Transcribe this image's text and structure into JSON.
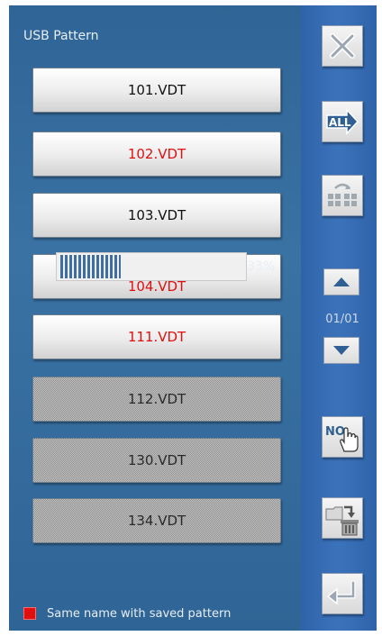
{
  "screen": {
    "title": "USB Pattern"
  },
  "files": [
    {
      "label": "101.VDT",
      "state": "normal"
    },
    {
      "label": "102.VDT",
      "state": "same-name"
    },
    {
      "label": "103.VDT",
      "state": "normal"
    },
    {
      "label": "104.VDT",
      "state": "same-name"
    },
    {
      "label": "111.VDT",
      "state": "same-name"
    },
    {
      "label": "112.VDT",
      "state": "disabled"
    },
    {
      "label": "130.VDT",
      "state": "disabled"
    },
    {
      "label": "134.VDT",
      "state": "disabled"
    }
  ],
  "progress": {
    "value_percent": 33,
    "label": "33%"
  },
  "side": {
    "close_icon": "close-x-icon",
    "select_all_icon": "all-arrow-icon",
    "invert_icon": "grid-rotate-icon",
    "page": "01/01",
    "number_icon": "no-hand-icon",
    "delete_icon": "folder-trash-icon",
    "return_icon": "return-arrow-icon"
  },
  "legend": {
    "text": "Same name with saved pattern",
    "color": "#e01010"
  },
  "colors": {
    "panel": "#2f6596",
    "side_panel": "#3b73bb",
    "same_name_text": "#e01010"
  }
}
